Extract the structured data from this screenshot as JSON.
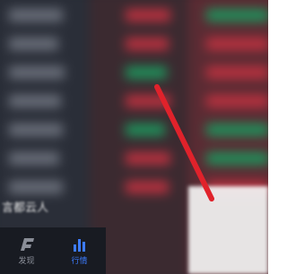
{
  "caption_text": "言都云人",
  "tabs": [
    {
      "id": "discover",
      "label": "发现",
      "icon": "f-logo-icon",
      "active": false
    },
    {
      "id": "market",
      "label": "行情",
      "icon": "bar-chart-icon",
      "active": true
    }
  ],
  "colors": {
    "up": "#b8313f",
    "down": "#1f8f5a",
    "active_tab": "#3d7cff",
    "arrow": "#e0222b"
  }
}
